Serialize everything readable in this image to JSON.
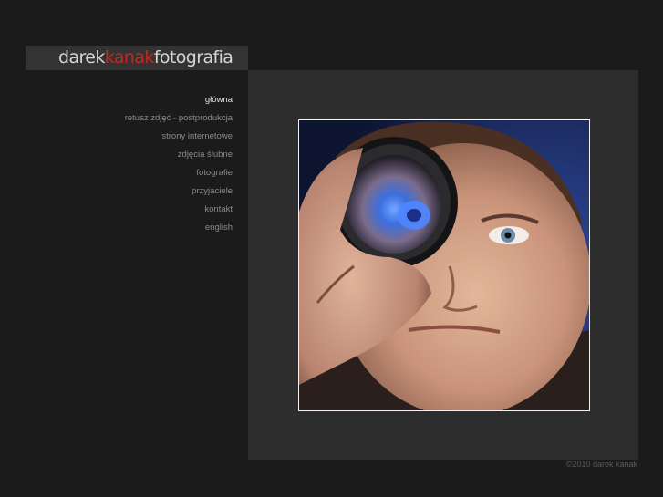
{
  "logo": {
    "part1": "darek",
    "part2": "kanak",
    "part3": "fotografia"
  },
  "nav": {
    "items": [
      {
        "label": "główna",
        "active": true
      },
      {
        "label": "retusz zdjęć - postprodukcja"
      },
      {
        "label": "strony internetowe"
      },
      {
        "label": "zdjęcia ślubne"
      },
      {
        "label": "fotografie"
      },
      {
        "label": "przyjaciele"
      },
      {
        "label": "kontakt"
      },
      {
        "label": "english"
      }
    ]
  },
  "footer": {
    "copyright": "©2010 darek kanak"
  },
  "colors": {
    "accent": "#c8261f",
    "background": "#1b1b1b",
    "panel": "#2d2d2d"
  }
}
